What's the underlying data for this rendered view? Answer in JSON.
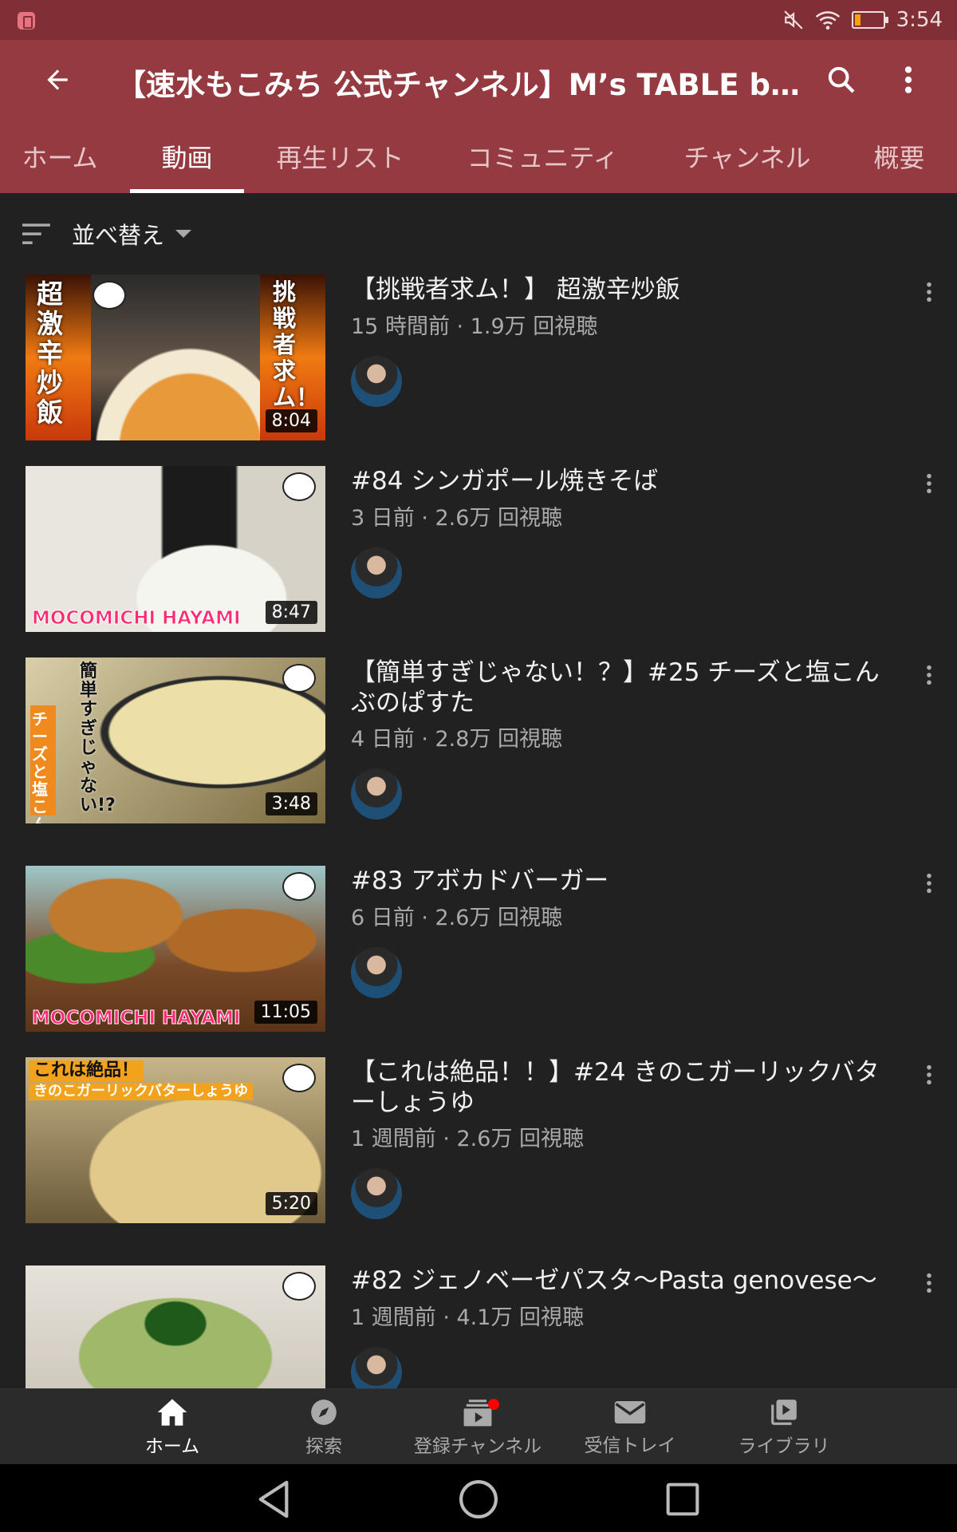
{
  "status_bar": {
    "time": "3:54",
    "icons": [
      "notification-icon",
      "mute-icon",
      "wifi-icon",
      "battery-icon"
    ]
  },
  "header": {
    "title": "【速水もこみち 公式チャンネル】M’s TABLE by MOCOMICHI HAYAMI",
    "back_icon": "arrow-back-icon",
    "search_icon": "search-icon",
    "more_icon": "more-vert-icon"
  },
  "tabs": [
    {
      "label": "ホーム",
      "active": false
    },
    {
      "label": "動画",
      "active": true
    },
    {
      "label": "再生リスト",
      "active": false
    },
    {
      "label": "コミュニティ",
      "active": false
    },
    {
      "label": "チャンネル",
      "active": false
    },
    {
      "label": "概要",
      "active": false
    }
  ],
  "sort": {
    "label": "並べ替え",
    "icon": "sort-icon"
  },
  "videos": [
    {
      "title": "【挑戦者求ム！】 超激辛炒飯",
      "meta": "15 時間前 · 1.9万 回視聴",
      "duration": "8:04",
      "thumb_text_left": "超激辛炒飯",
      "thumb_text_right": "挑戦者求ム！"
    },
    {
      "title": "#84 シンガポール焼きそば",
      "meta": "3 日前 · 2.6万 回視聴",
      "duration": "8:47",
      "thumb_text": "MOCOMICHI HAYAMI"
    },
    {
      "title": "【簡単すぎじゃない！？】#25 チーズと塩こんぶのぱすた",
      "meta": "4 日前 · 2.8万 回視聴",
      "duration": "3:48",
      "thumb_text_left": "チーズと塩こんぶのぱすた",
      "thumb_text_right": "簡単すぎじゃない!?"
    },
    {
      "title": "#83 アボカドバーガー",
      "meta": "6 日前 · 2.6万 回視聴",
      "duration": "11:05",
      "thumb_text": "MOCOMICHI HAYAMI"
    },
    {
      "title": "【これは絶品！！】#24 きのこガーリックバターしょうゆ",
      "meta": "1 週間前 · 2.6万 回視聴",
      "duration": "5:20",
      "thumb_text_left": "これは絶品！",
      "thumb_text_right": "きのこガーリックバターしょうゆ"
    },
    {
      "title": "#82 ジェノベーゼパスタ〜Pasta genovese〜",
      "meta": "1 週間前 · 4.1万 回視聴",
      "duration": ""
    }
  ],
  "bottom_nav": [
    {
      "label": "ホーム",
      "icon": "home-icon",
      "active": true
    },
    {
      "label": "探索",
      "icon": "explore-icon",
      "active": false
    },
    {
      "label": "登録チャンネル",
      "icon": "subscriptions-icon",
      "active": false,
      "badge": true
    },
    {
      "label": "受信トレイ",
      "icon": "inbox-icon",
      "active": false
    },
    {
      "label": "ライブラリ",
      "icon": "library-icon",
      "active": false
    }
  ],
  "colors": {
    "accent": "#953a41",
    "status_bar": "#7f2f35",
    "background": "#212121",
    "nav_bar": "#2b2b2b",
    "badge": "#ff0000"
  }
}
